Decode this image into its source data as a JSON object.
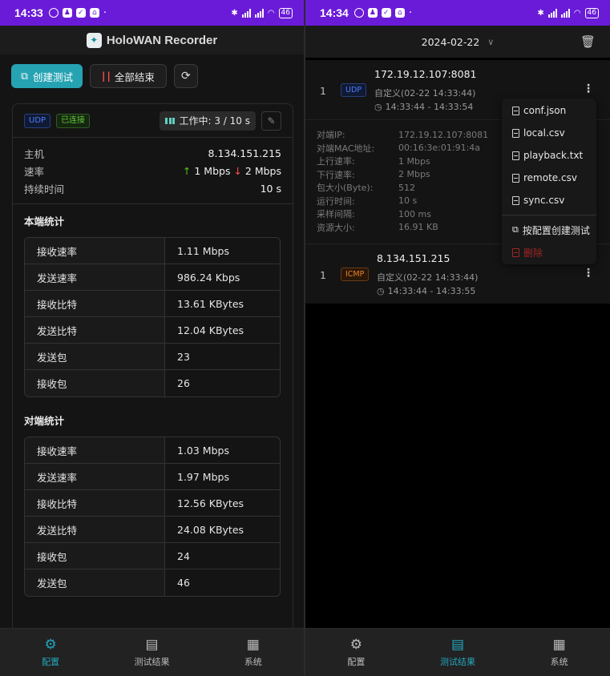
{
  "left": {
    "status_bar": {
      "time": "14:33",
      "battery": "46"
    },
    "app_title": "HoloWAN Recorder",
    "actions": {
      "create_label": "创建测试",
      "stop_all_label": "全部结束"
    },
    "card": {
      "protocol_tag": "UDP",
      "connected_tag": "已连接",
      "working_status": "工作中: 3 / 10 s",
      "info": [
        {
          "key": "主机",
          "value": "8.134.151.215"
        },
        {
          "key": "速率",
          "up": "1 Mbps",
          "down": "2 Mbps"
        },
        {
          "key": "持续时间",
          "value": "10 s"
        }
      ],
      "local_title": "本端统计",
      "local_stats": [
        {
          "k": "接收速率",
          "v": "1.11 Mbps"
        },
        {
          "k": "发送速率",
          "v": "986.24 Kbps"
        },
        {
          "k": "接收比特",
          "v": "13.61 KBytes"
        },
        {
          "k": "发送比特",
          "v": "12.04 KBytes"
        },
        {
          "k": "发送包",
          "v": "23"
        },
        {
          "k": "接收包",
          "v": "26"
        }
      ],
      "remote_title": "对端统计",
      "remote_stats": [
        {
          "k": "接收速率",
          "v": "1.03 Mbps"
        },
        {
          "k": "发送速率",
          "v": "1.97 Mbps"
        },
        {
          "k": "接收比特",
          "v": "12.56 KBytes"
        },
        {
          "k": "发送比特",
          "v": "24.08 KBytes"
        },
        {
          "k": "接收包",
          "v": "24"
        },
        {
          "k": "发送包",
          "v": "46"
        }
      ]
    },
    "nav": [
      {
        "label": "配置",
        "active": true
      },
      {
        "label": "测试结果",
        "active": false
      },
      {
        "label": "系统",
        "active": false
      }
    ]
  },
  "right": {
    "status_bar": {
      "time": "14:34",
      "battery": "46"
    },
    "date": "2024-02-22",
    "results": [
      {
        "index": "1",
        "protocol": "UDP",
        "address": "172.19.12.107:8081",
        "description": "自定义(02-22 14:33:44)",
        "time_range": "14:33:44 - 14:33:54"
      },
      {
        "index": "1",
        "protocol": "ICMP",
        "address": "8.134.151.215",
        "description": "自定义(02-22 14:33:44)",
        "time_range": "14:33:44 - 14:33:55"
      }
    ],
    "detail": [
      {
        "k": "对端IP:",
        "v": "172.19.12.107:8081"
      },
      {
        "k": "对端MAC地址:",
        "v": "00:16:3e:01:91:4a"
      },
      {
        "k": "上行速率:",
        "v": "1 Mbps"
      },
      {
        "k": "下行速率:",
        "v": "2 Mbps"
      },
      {
        "k": "包大小(Byte):",
        "v": "512"
      },
      {
        "k": "运行时间:",
        "v": "10 s"
      },
      {
        "k": "采样间隔:",
        "v": "100 ms"
      },
      {
        "k": "资源大小:",
        "v": "16.91 KB"
      }
    ],
    "menu": {
      "files": [
        "conf.json",
        "local.csv",
        "playback.txt",
        "remote.csv",
        "sync.csv"
      ],
      "create_from_config": "按配置创建测试",
      "delete": "删除"
    },
    "nav": [
      {
        "label": "配置",
        "active": false
      },
      {
        "label": "测试结果",
        "active": true
      },
      {
        "label": "系统",
        "active": false
      }
    ]
  },
  "colors": {
    "status_bar": "#6a1bd8",
    "accent": "#26a3b3",
    "danger": "#ff4d4f",
    "success": "#52c41a"
  }
}
